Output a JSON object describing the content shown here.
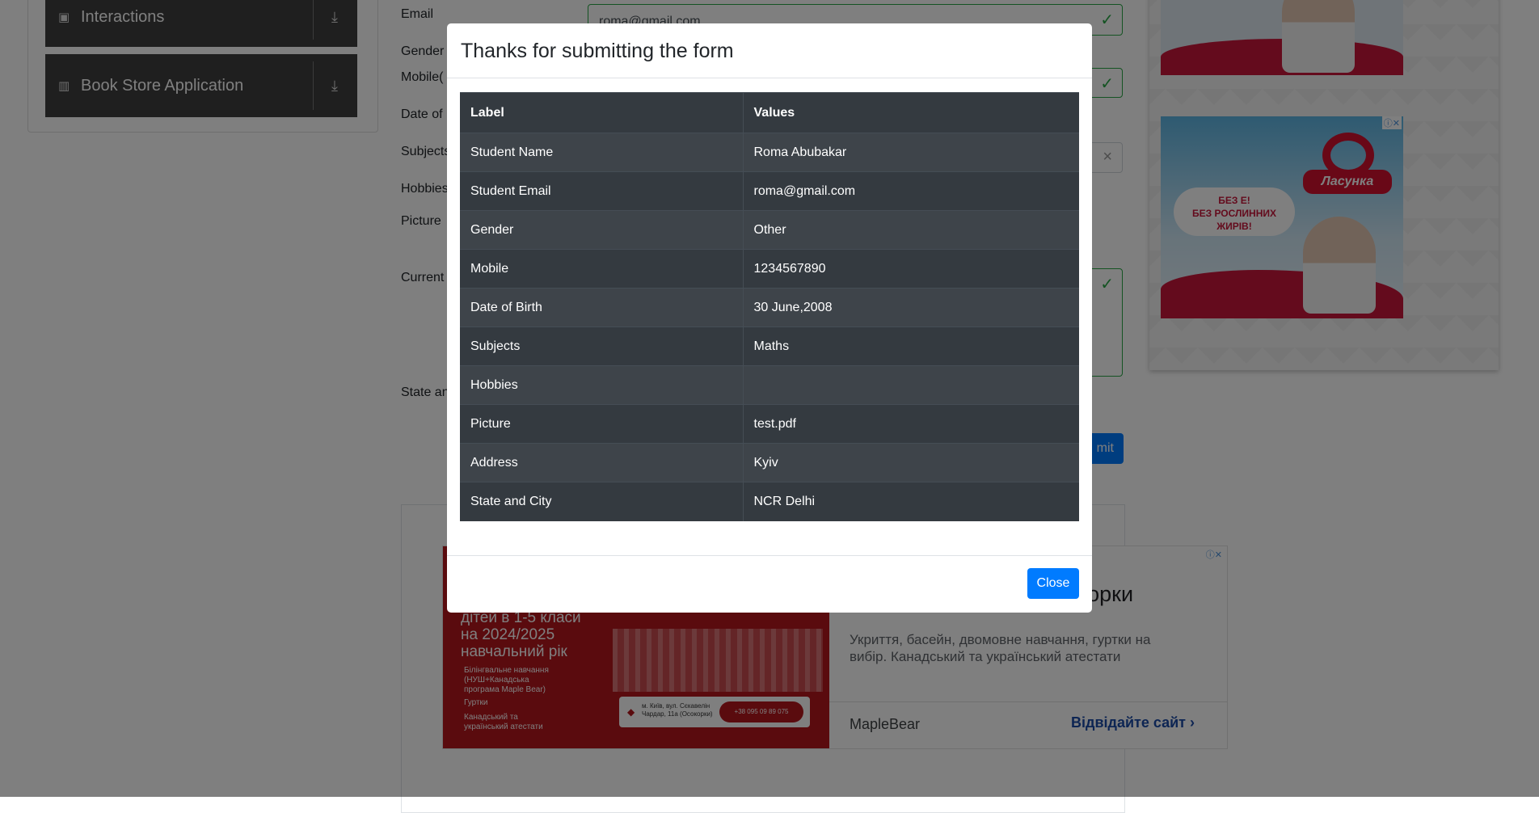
{
  "sidebar": {
    "groups": [
      {
        "label": "Interactions",
        "icon": "interactions-icon"
      },
      {
        "label": "Book Store Application",
        "icon": "book-store-icon"
      }
    ]
  },
  "form": {
    "labels": {
      "email": "Email",
      "gender": "Gender",
      "mobile": "Mobile(",
      "dob": "Date of",
      "subjects": "Subjects",
      "hobbies": "Hobbies",
      "picture": "Picture",
      "current_address": "Current",
      "state_city": "State an"
    },
    "email_value": "roma@gmail.com",
    "submit_label": "mit"
  },
  "ads": {
    "right_bubble": "БЕЗ Е!\nБЕЗ РОСЛИННИХ\nЖИРІВ!",
    "right_brand": "Ласунка",
    "bottom": {
      "image_lines": [
        "дітей в 1-5 класи",
        "на 2024/2025",
        "навчальний рік"
      ],
      "bullets": [
        "Білінгвальне навчання (НУШ+Канадська програма Maple Bear)",
        "Гуртки",
        "Канадський та український атестати"
      ],
      "address": "м. Київ, вул. Сєкавелін Чардар, 11а (Осокорки)",
      "phone": "+38 095 09 89 075",
      "headline": "окорки",
      "description": "Укриття, басейн, двомовне навчання, гуртки на вибір. Канадський та український атестати",
      "advertiser": "MapleBear",
      "cta": "Відвідайте сайт"
    }
  },
  "modal": {
    "title": "Thanks for submitting the form",
    "table": {
      "headers": [
        "Label",
        "Values"
      ],
      "rows": [
        [
          "Student Name",
          "Roma Abubakar"
        ],
        [
          "Student Email",
          "roma@gmail.com"
        ],
        [
          "Gender",
          "Other"
        ],
        [
          "Mobile",
          "1234567890"
        ],
        [
          "Date of Birth",
          "30 June,2008"
        ],
        [
          "Subjects",
          "Maths"
        ],
        [
          "Hobbies",
          ""
        ],
        [
          "Picture",
          "test.pdf"
        ],
        [
          "Address",
          "Kyiv"
        ],
        [
          "State and City",
          "NCR Delhi"
        ]
      ]
    },
    "close_label": "Close"
  },
  "colors": {
    "primary": "#007bff",
    "table_dark": "#343a40",
    "table_stripe": "#3e444a",
    "valid_green": "#28a745",
    "backdrop": "rgba(0,0,0,0.5)"
  }
}
